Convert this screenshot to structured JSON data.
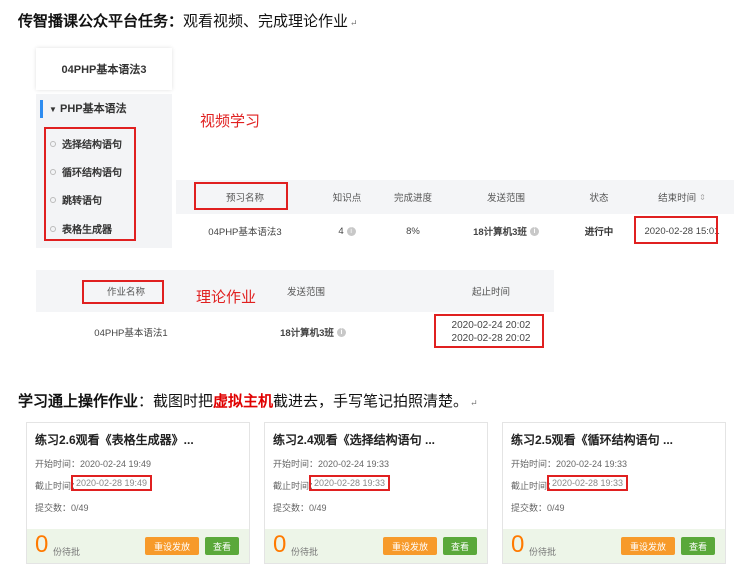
{
  "heading1": {
    "bold": "传智播课公众平台任务：",
    "rest": "观看视频、完成理论作业"
  },
  "return_mark": "↵",
  "course": {
    "title": "04PHP基本语法3",
    "section": "PHP基本语法",
    "items": [
      "选择结构语句",
      "循环结构语句",
      "跳转语句",
      "表格生成器"
    ]
  },
  "label_video": "视频学习",
  "preview_table": {
    "headers": [
      "预习名称",
      "知识点",
      "完成进度",
      "发送范围",
      "状态",
      "结束时间"
    ],
    "row": {
      "name": "04PHP基本语法3",
      "points": "4",
      "progress": "8%",
      "scope": "18计算机3班",
      "status": "进行中",
      "end": "2020-02-28 15:01"
    }
  },
  "label_theory": "理论作业",
  "homework_table": {
    "headers": [
      "作业名称",
      "发送范围",
      "起止时间"
    ],
    "row": {
      "name": "04PHP基本语法1",
      "scope": "18计算机3班",
      "start": "2020-02-24 20:02",
      "end": "2020-02-28 20:02"
    }
  },
  "heading2": {
    "bold": "学习通上操作作业",
    "mid": "：截图时把",
    "red": "虚拟主机",
    "rest": "截进去，手写笔记拍照清楚。"
  },
  "cards": [
    {
      "title": "练习2.6观看《表格生成器》...",
      "start": "开始时间：2020-02-24 19:49",
      "deadline_label": "截止时间：",
      "deadline": "2020-02-28 19:49",
      "submitted": "提交数：0/49",
      "count": "0",
      "pending": "份待批",
      "btn1": "重设发放",
      "btn2": "查看"
    },
    {
      "title": "练习2.4观看《选择结构语句 ...",
      "start": "开始时间：2020-02-24 19:33",
      "deadline_label": "截止时间：",
      "deadline": "2020-02-28 19:33",
      "submitted": "提交数：0/49",
      "count": "0",
      "pending": "份待批",
      "btn1": "重设发放",
      "btn2": "查看"
    },
    {
      "title": "练习2.5观看《循环结构语句 ...",
      "start": "开始时间：2020-02-24 19:33",
      "deadline_label": "截止时间：",
      "deadline": "2020-02-28 19:33",
      "submitted": "提交数：0/49",
      "count": "0",
      "pending": "份待批",
      "btn1": "重设发放",
      "btn2": "查看"
    }
  ]
}
